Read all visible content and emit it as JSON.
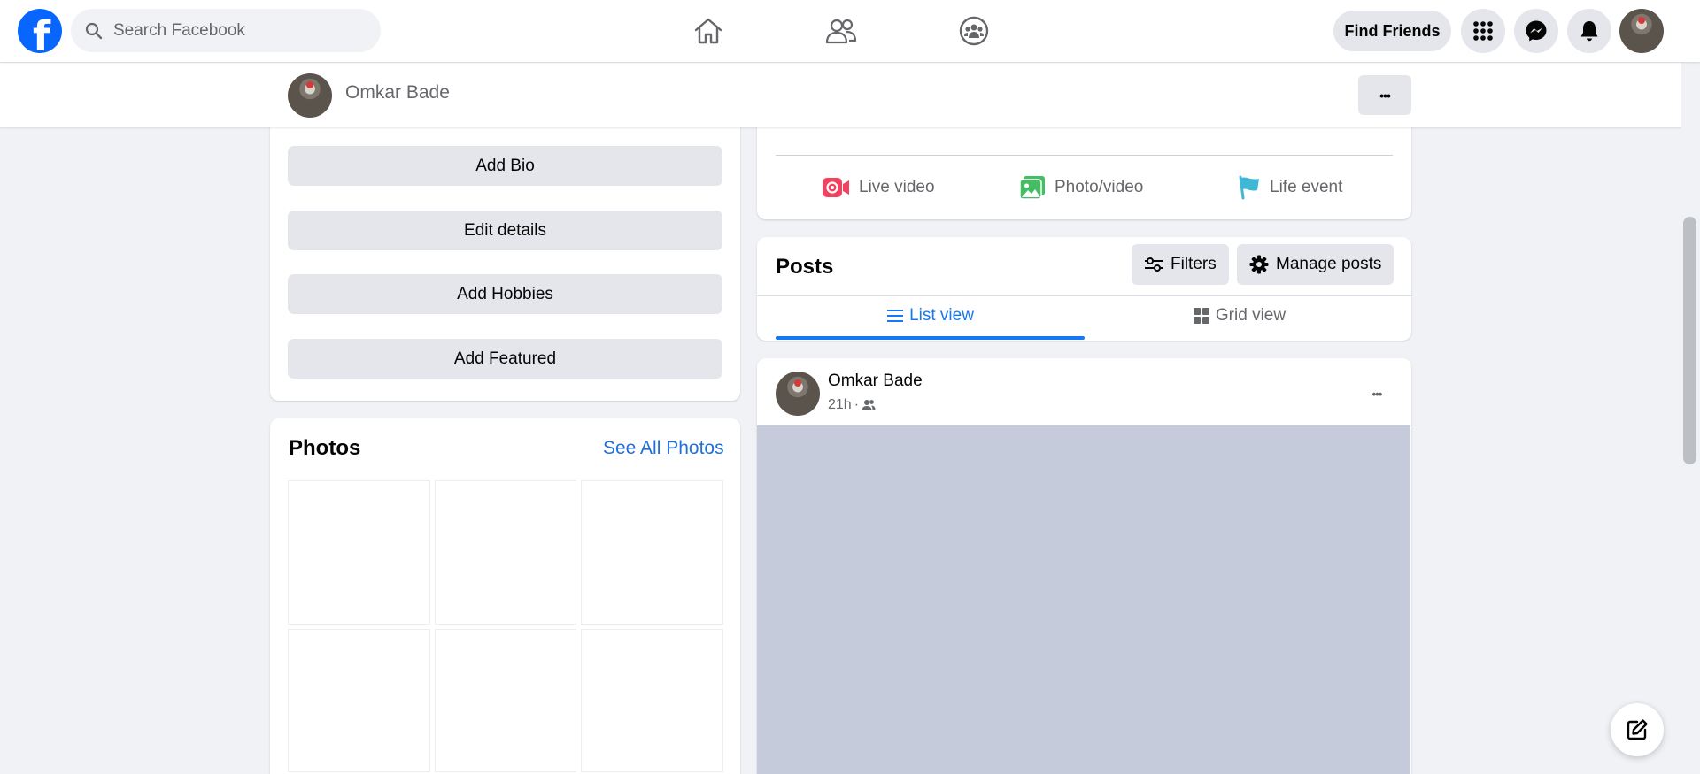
{
  "topbar": {
    "logo": "facebook-logo",
    "logo_glyph": "f",
    "search_placeholder": "Search Facebook",
    "nav": [
      "home-icon",
      "friends-icon",
      "groups-icon"
    ],
    "find_friends_label": "Find Friends",
    "right_icons": [
      "menu-grid-icon",
      "messenger-icon",
      "notifications-bell-icon"
    ]
  },
  "profile_bar": {
    "name": "Omkar Bade",
    "more_glyph": "•••"
  },
  "intro_buttons": [
    "Add Bio",
    "Edit details",
    "Add Hobbies",
    "Add Featured"
  ],
  "photos": {
    "title": "Photos",
    "see_all_label": "See All Photos"
  },
  "composer": {
    "actions": [
      {
        "label": "Live video",
        "icon": "live-video-icon",
        "color": "#f3425f"
      },
      {
        "label": "Photo/video",
        "icon": "photo-video-icon",
        "color": "#45bd62"
      },
      {
        "label": "Life event",
        "icon": "life-event-flag-icon",
        "color": "#3eb8d5"
      }
    ]
  },
  "posts": {
    "title": "Posts",
    "filters_label": "Filters",
    "manage_label": "Manage posts",
    "tabs": [
      {
        "label": "List view",
        "active": true
      },
      {
        "label": "Grid view",
        "active": false
      }
    ]
  },
  "post": {
    "author": "Omkar Bade",
    "time": "21h",
    "separator": "·",
    "audience_icon": "friends-audience-icon",
    "more_glyph": "•••",
    "image_placeholder_color": "#c6cbdb"
  },
  "colors": {
    "brand": "#0866ff",
    "link": "#216fdb",
    "background": "#f0f2f5",
    "button_gray": "#e4e6eb"
  }
}
